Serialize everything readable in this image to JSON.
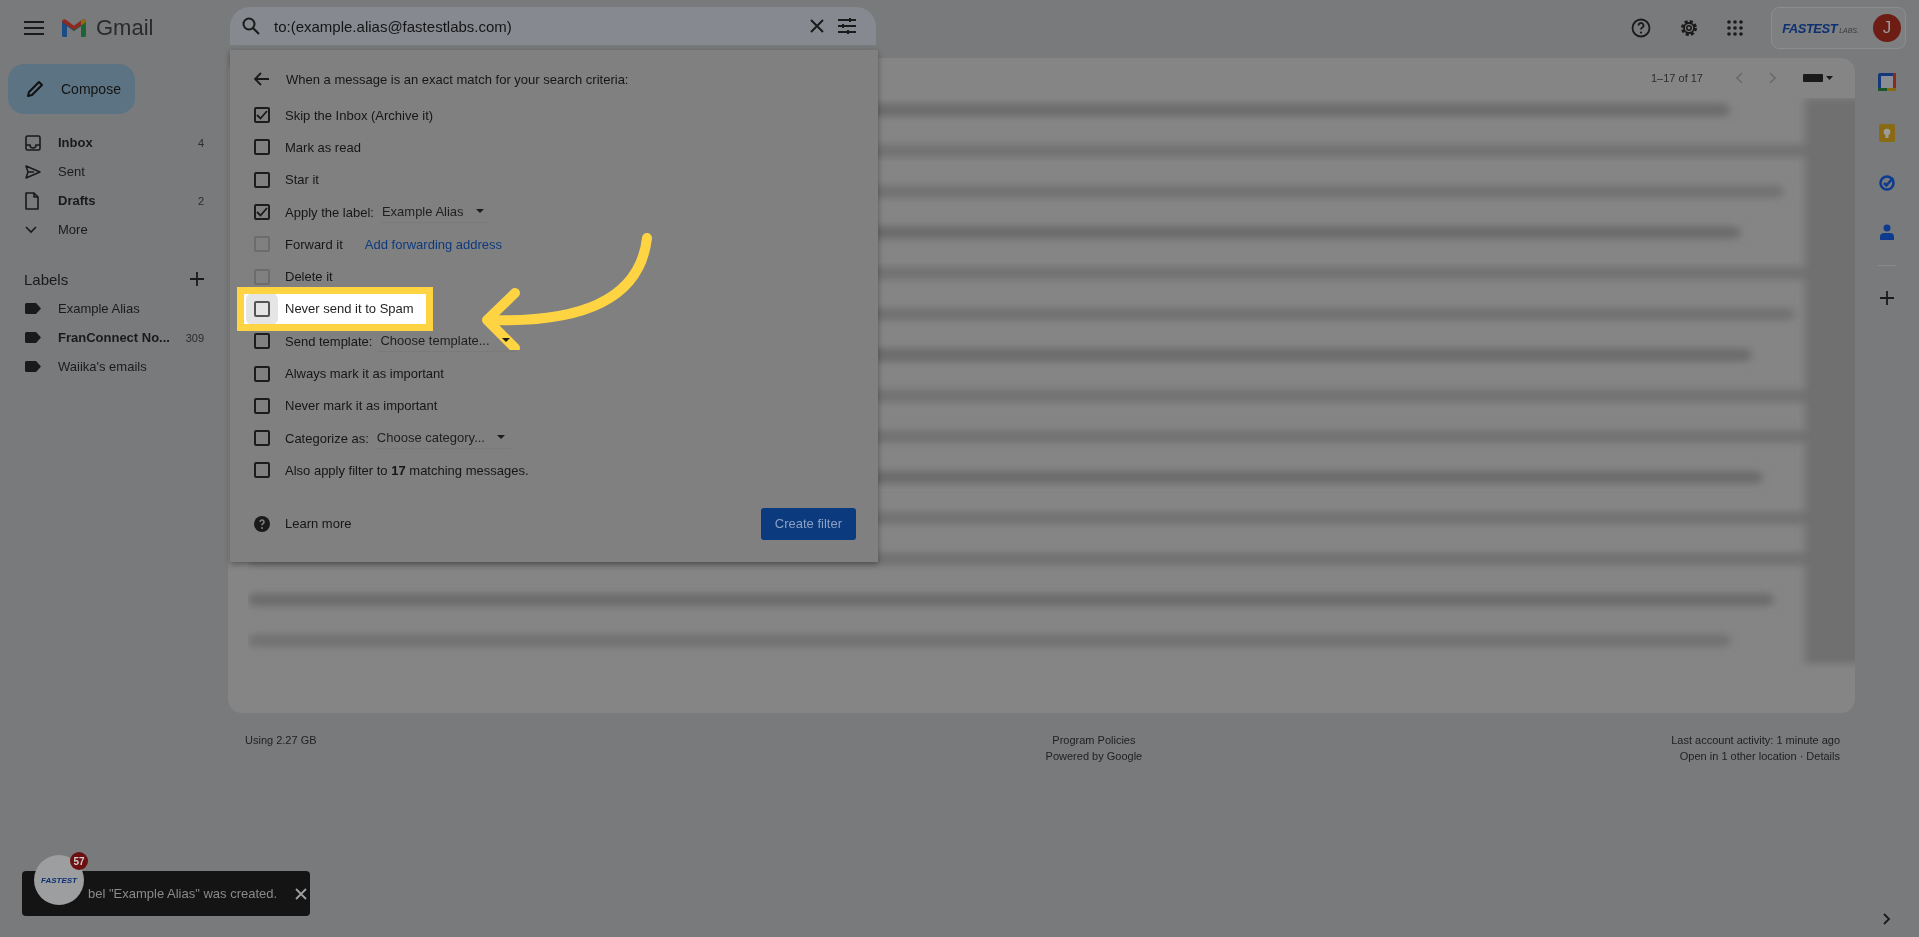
{
  "header": {
    "product": "Gmail"
  },
  "search": {
    "value": "to:(example.alias@fastestlabs.com)"
  },
  "account": {
    "logo_main": "FASTEST",
    "logo_sub": "LABS.",
    "avatar": "J"
  },
  "compose": "Compose",
  "nav": [
    {
      "kind": "inbox",
      "label": "Inbox",
      "count": "4",
      "unread": true
    },
    {
      "kind": "sent",
      "label": "Sent",
      "unread": false
    },
    {
      "kind": "drafts",
      "label": "Drafts",
      "count": "2",
      "unread": true
    },
    {
      "kind": "more",
      "label": "More",
      "unread": false
    }
  ],
  "labels": {
    "title": "Labels",
    "items": [
      {
        "name": "Example Alias",
        "unread": false
      },
      {
        "name": "FranConnect No...",
        "count": "309",
        "unread": true
      },
      {
        "name": "Waiika's emails",
        "unread": false
      }
    ]
  },
  "filter_dialog": {
    "heading": "When a message is an exact match for your search criteria:",
    "options": [
      {
        "kind": "plain",
        "label": "Skip the Inbox (Archive it)",
        "checked": true,
        "disabled": false,
        "highlighted": false
      },
      {
        "kind": "plain",
        "label": "Mark as read",
        "checked": false,
        "disabled": false,
        "highlighted": false
      },
      {
        "kind": "plain",
        "label": "Star it",
        "checked": false,
        "disabled": false,
        "highlighted": false
      },
      {
        "kind": "select",
        "label": "Apply the label:",
        "select": "Example Alias",
        "checked": true,
        "disabled": false,
        "highlighted": false
      },
      {
        "kind": "link",
        "label": "Forward it",
        "link": "Add forwarding address",
        "checked": false,
        "disabled": true,
        "highlighted": false
      },
      {
        "kind": "plain",
        "label": "Delete it",
        "checked": false,
        "disabled": true,
        "highlighted": false
      },
      {
        "kind": "plain",
        "label": "Never send it to Spam",
        "checked": false,
        "disabled": false,
        "highlighted": true
      },
      {
        "kind": "select",
        "label": "Send template:",
        "select": "Choose template...",
        "checked": false,
        "disabled": false,
        "highlighted": false
      },
      {
        "kind": "plain",
        "label": "Always mark it as important",
        "checked": false,
        "disabled": false,
        "highlighted": false
      },
      {
        "kind": "plain",
        "label": "Never mark it as important",
        "checked": false,
        "disabled": false,
        "highlighted": false
      },
      {
        "kind": "select",
        "label": "Categorize as:",
        "select": "Choose category...",
        "checked": false,
        "disabled": false,
        "highlighted": false
      },
      {
        "kind": "plain",
        "label": "Also apply filter to **17** matching messages.",
        "checked": false,
        "disabled": false,
        "highlighted": false
      }
    ],
    "learn_more": "Learn more",
    "create_button": "Create filter"
  },
  "list": {
    "range": "1–17 of 17"
  },
  "footer": {
    "storage": "Using 2.27 GB",
    "policies": "Program Policies",
    "powered": "Powered by Google",
    "activity": "Last account activity: 1 minute ago",
    "other_location": "Open in 1 other location · Details"
  },
  "toast": {
    "badge": "57",
    "avatar_logo": "FASTEST",
    "text": "bel \"Example Alias\" was created."
  }
}
